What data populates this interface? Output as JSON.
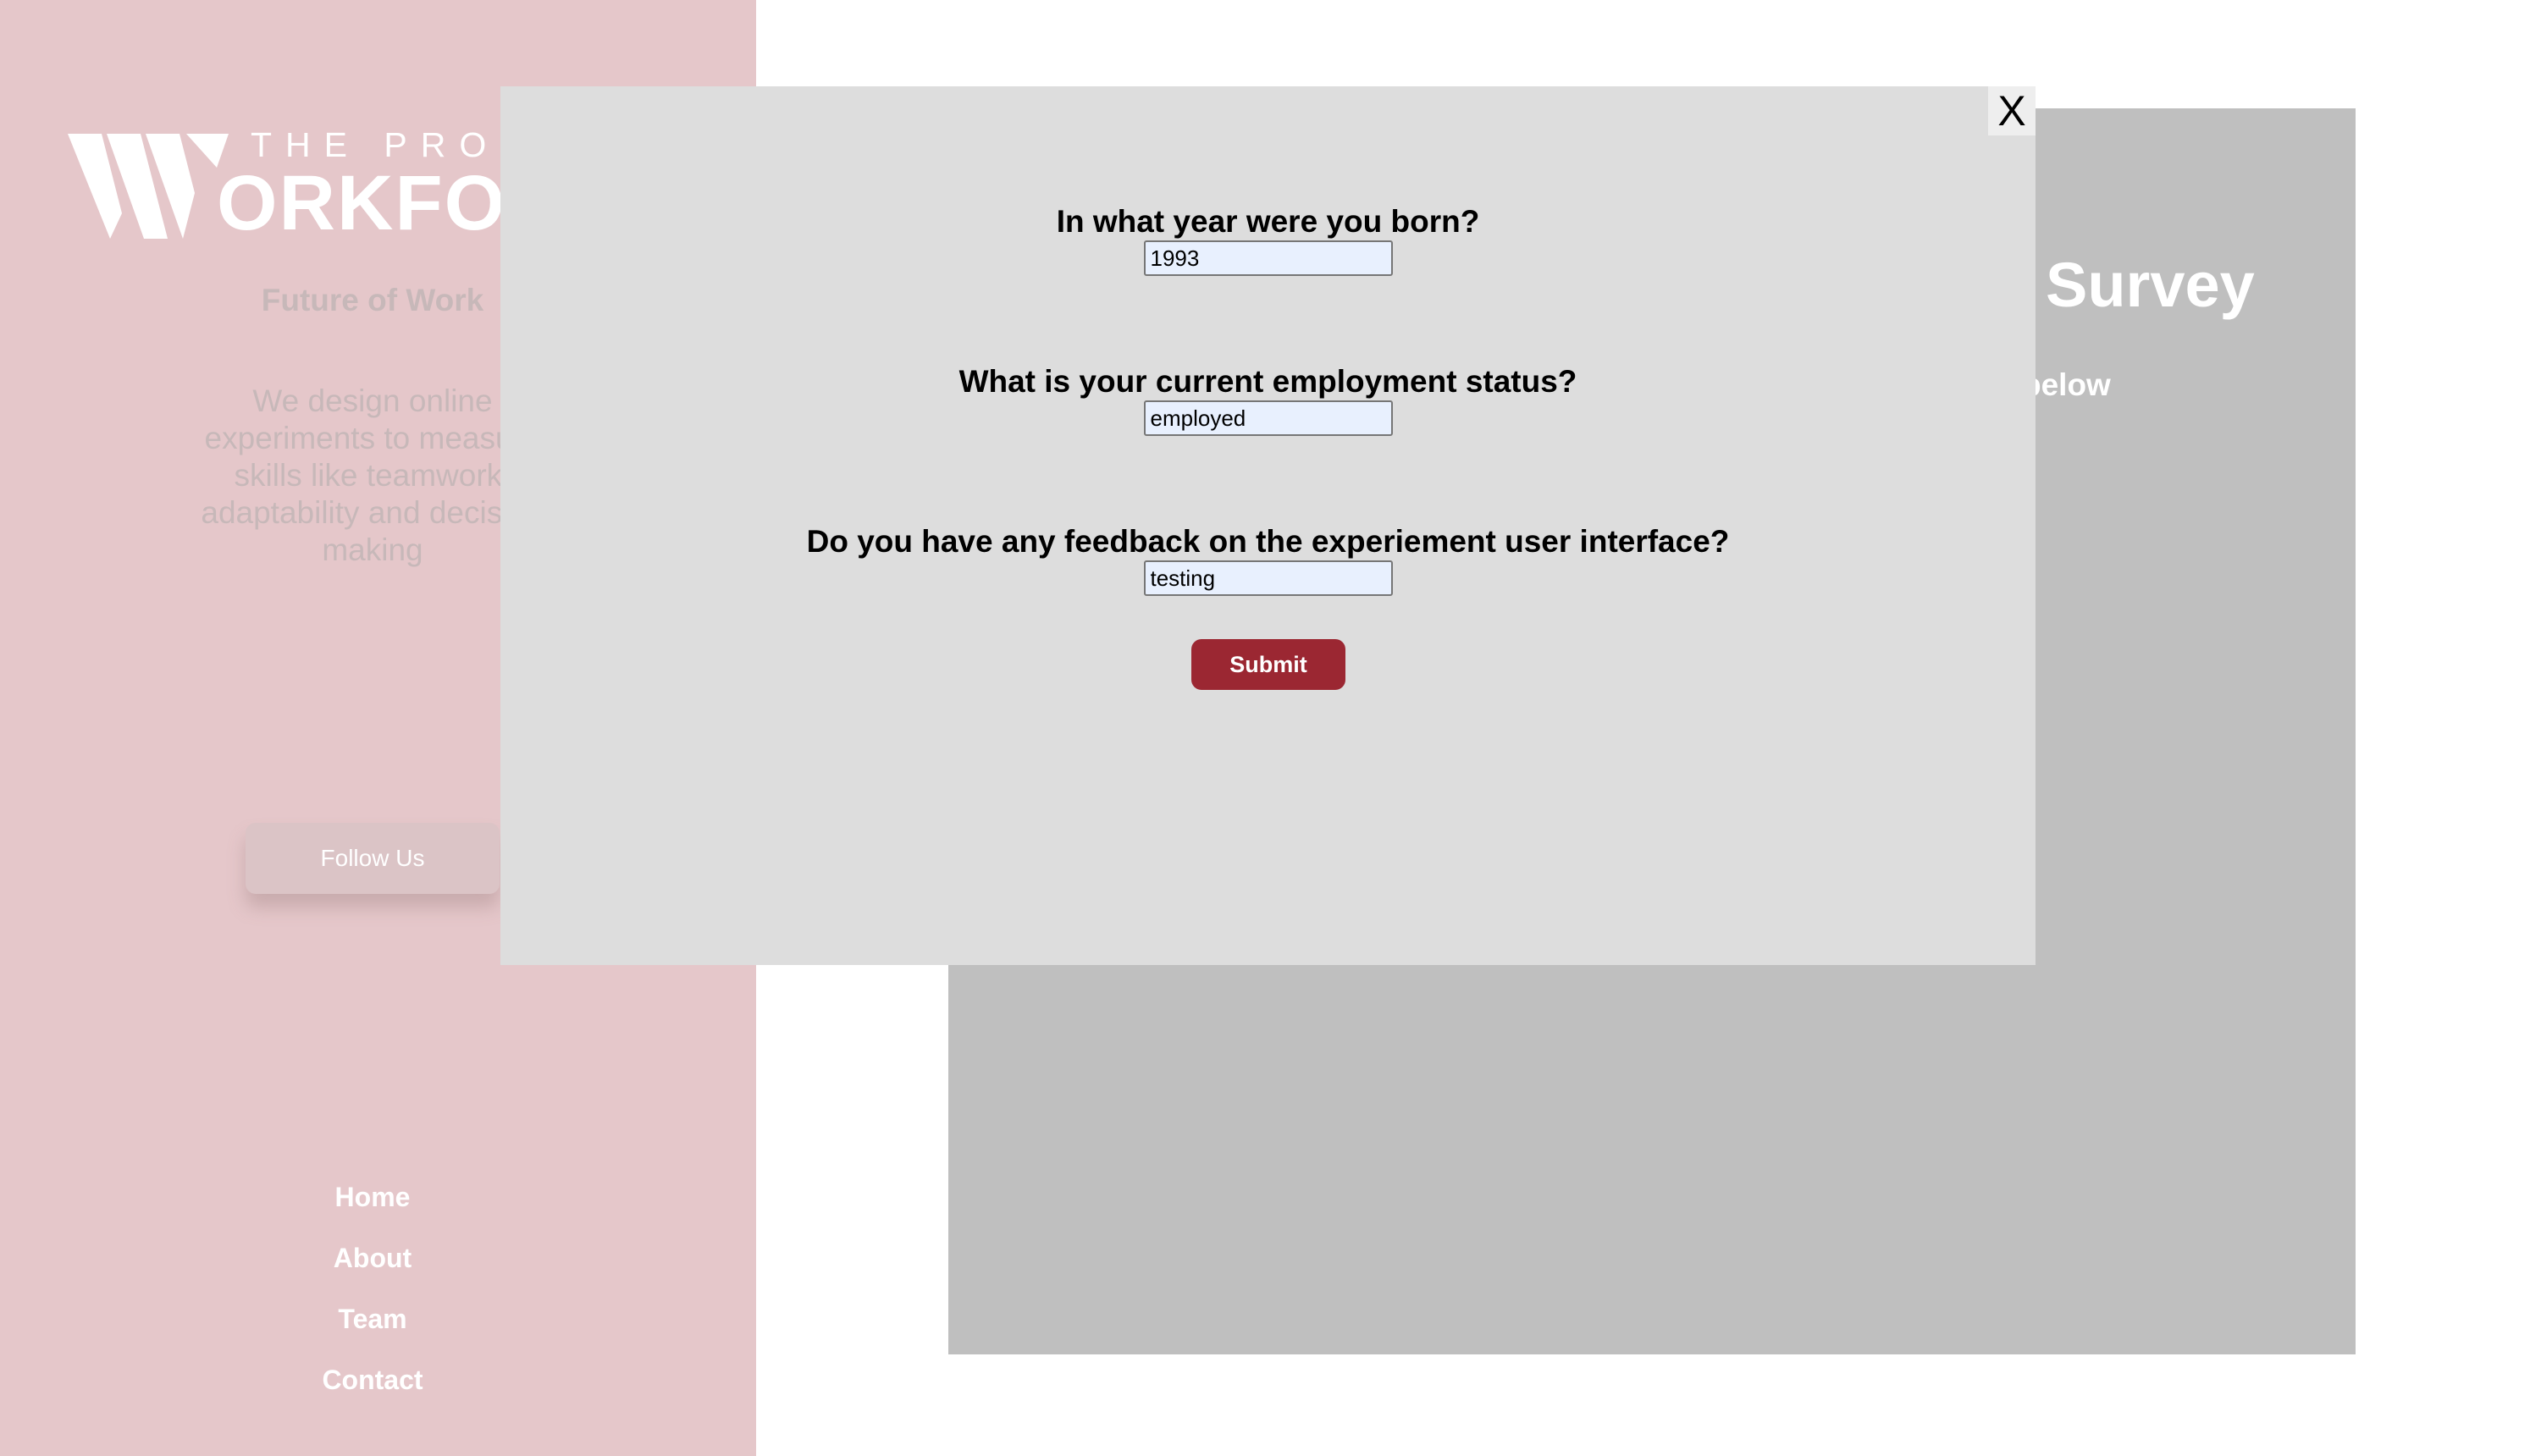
{
  "sidebar": {
    "logo_top": "THE PROJECT",
    "logo_main": "ORKFORCE",
    "tagline": "Future of Work",
    "description": "We design online experiments to measure skills like teamwork, adaptability and decision making",
    "follow_label": "Follow Us",
    "nav": [
      {
        "label": "Home"
      },
      {
        "label": "About"
      },
      {
        "label": "Team"
      },
      {
        "label": "Contact"
      }
    ]
  },
  "main": {
    "survey_title": "Survey",
    "survey_subtitle": "below"
  },
  "modal": {
    "close_label": "X",
    "questions": [
      {
        "label": "In what year were you born?",
        "value": "1993"
      },
      {
        "label": "What is your current employment status?",
        "value": "employed"
      },
      {
        "label": "Do you have any feedback on the experiement user interface?",
        "value": "testing"
      }
    ],
    "submit_label": "Submit"
  },
  "colors": {
    "sidebar_bg": "#e5c7ca",
    "panel_bg": "#bfbfbf",
    "modal_bg": "#dddddd",
    "submit_bg": "#9b2732",
    "input_bg": "#e8f0fe"
  }
}
